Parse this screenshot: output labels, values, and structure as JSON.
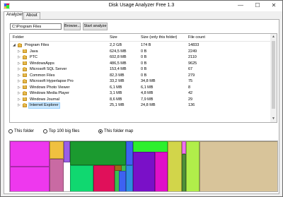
{
  "window": {
    "title": "Disk Usage Analyzer Free 1.3",
    "minimize_glyph": "—",
    "maximize_glyph": "☐",
    "close_glyph": "✕"
  },
  "tabs": [
    {
      "label": "Analyzer",
      "active": true
    },
    {
      "label": "About",
      "active": false
    }
  ],
  "toolbar": {
    "path_value": "C:\\Program Files",
    "browse_label": "Browse...",
    "start_label": "Start analyze"
  },
  "tree": {
    "columns": [
      "Folder",
      "Size",
      "Size (only this folder)",
      "File count"
    ],
    "rows": [
      {
        "level": 0,
        "expanded": true,
        "name": "Program Files",
        "size": "2,2 GB",
        "own_size": "174 B",
        "count": "14833",
        "selected": false
      },
      {
        "level": 1,
        "expanded": false,
        "name": "Java",
        "size": "624,5 MB",
        "own_size": "0 B",
        "count": "2249",
        "selected": false
      },
      {
        "level": 1,
        "expanded": false,
        "name": "PTC",
        "size": "602,8 MB",
        "own_size": "0 B",
        "count": "2110",
        "selected": false
      },
      {
        "level": 1,
        "expanded": false,
        "name": "WindowsApps",
        "size": "486,5 MB",
        "own_size": "0 B",
        "count": "9625",
        "selected": false
      },
      {
        "level": 1,
        "expanded": false,
        "name": "Microsoft SQL Server",
        "size": "153,4 MB",
        "own_size": "0 B",
        "count": "67",
        "selected": false
      },
      {
        "level": 1,
        "expanded": false,
        "name": "Common Files",
        "size": "82,3 MB",
        "own_size": "0 B",
        "count": "279",
        "selected": false
      },
      {
        "level": 1,
        "expanded": false,
        "name": "Microsoft Hyperlapse Pro",
        "size": "33,2 MB",
        "own_size": "34,8 MB",
        "count": "75",
        "selected": false
      },
      {
        "level": 1,
        "expanded": false,
        "name": "Windows Photo Viewer",
        "size": "6,1 MB",
        "own_size": "6,1 MB",
        "count": "8",
        "selected": false
      },
      {
        "level": 1,
        "expanded": false,
        "name": "Windows Media Player",
        "size": "3,1 MB",
        "own_size": "4,8 MB",
        "count": "42",
        "selected": false
      },
      {
        "level": 1,
        "expanded": false,
        "name": "Windows Journal",
        "size": "8,6 MB",
        "own_size": "7,9 MB",
        "count": "29",
        "selected": false
      },
      {
        "level": 1,
        "expanded": false,
        "name": "Internet Explorer",
        "size": "25,1 MB",
        "own_size": "24,8 MB",
        "count": "136",
        "selected": true
      }
    ]
  },
  "view_options": [
    {
      "label": "This folder",
      "checked": false
    },
    {
      "label": "Top 100 big files",
      "checked": false
    },
    {
      "label": "This folder map",
      "checked": true
    }
  ],
  "treemap": {
    "tiles": [
      {
        "color": "#ee38ee"
      },
      {
        "color": "#f0c040"
      },
      {
        "color": "#9a5ee8"
      },
      {
        "color": "#ee38ee"
      },
      {
        "color": "#c96aa3"
      },
      {
        "color": "#1b9a2f"
      },
      {
        "color": "#3d62f2"
      },
      {
        "color": "#10d870"
      },
      {
        "color": "#e0105a"
      },
      {
        "color": "#3bbf4f"
      },
      {
        "color": "#9d6a1b"
      },
      {
        "color": "#3d62f2"
      },
      {
        "color": "#2e8ee0"
      },
      {
        "color": "#2df02d"
      },
      {
        "color": "#7a10c8"
      },
      {
        "color": "#e010c8"
      },
      {
        "color": "#d2d54a"
      },
      {
        "color": "#f070f0"
      },
      {
        "color": "#b1ee4a"
      },
      {
        "color": "#4e8f38"
      },
      {
        "color": "#d8c49a"
      }
    ]
  }
}
